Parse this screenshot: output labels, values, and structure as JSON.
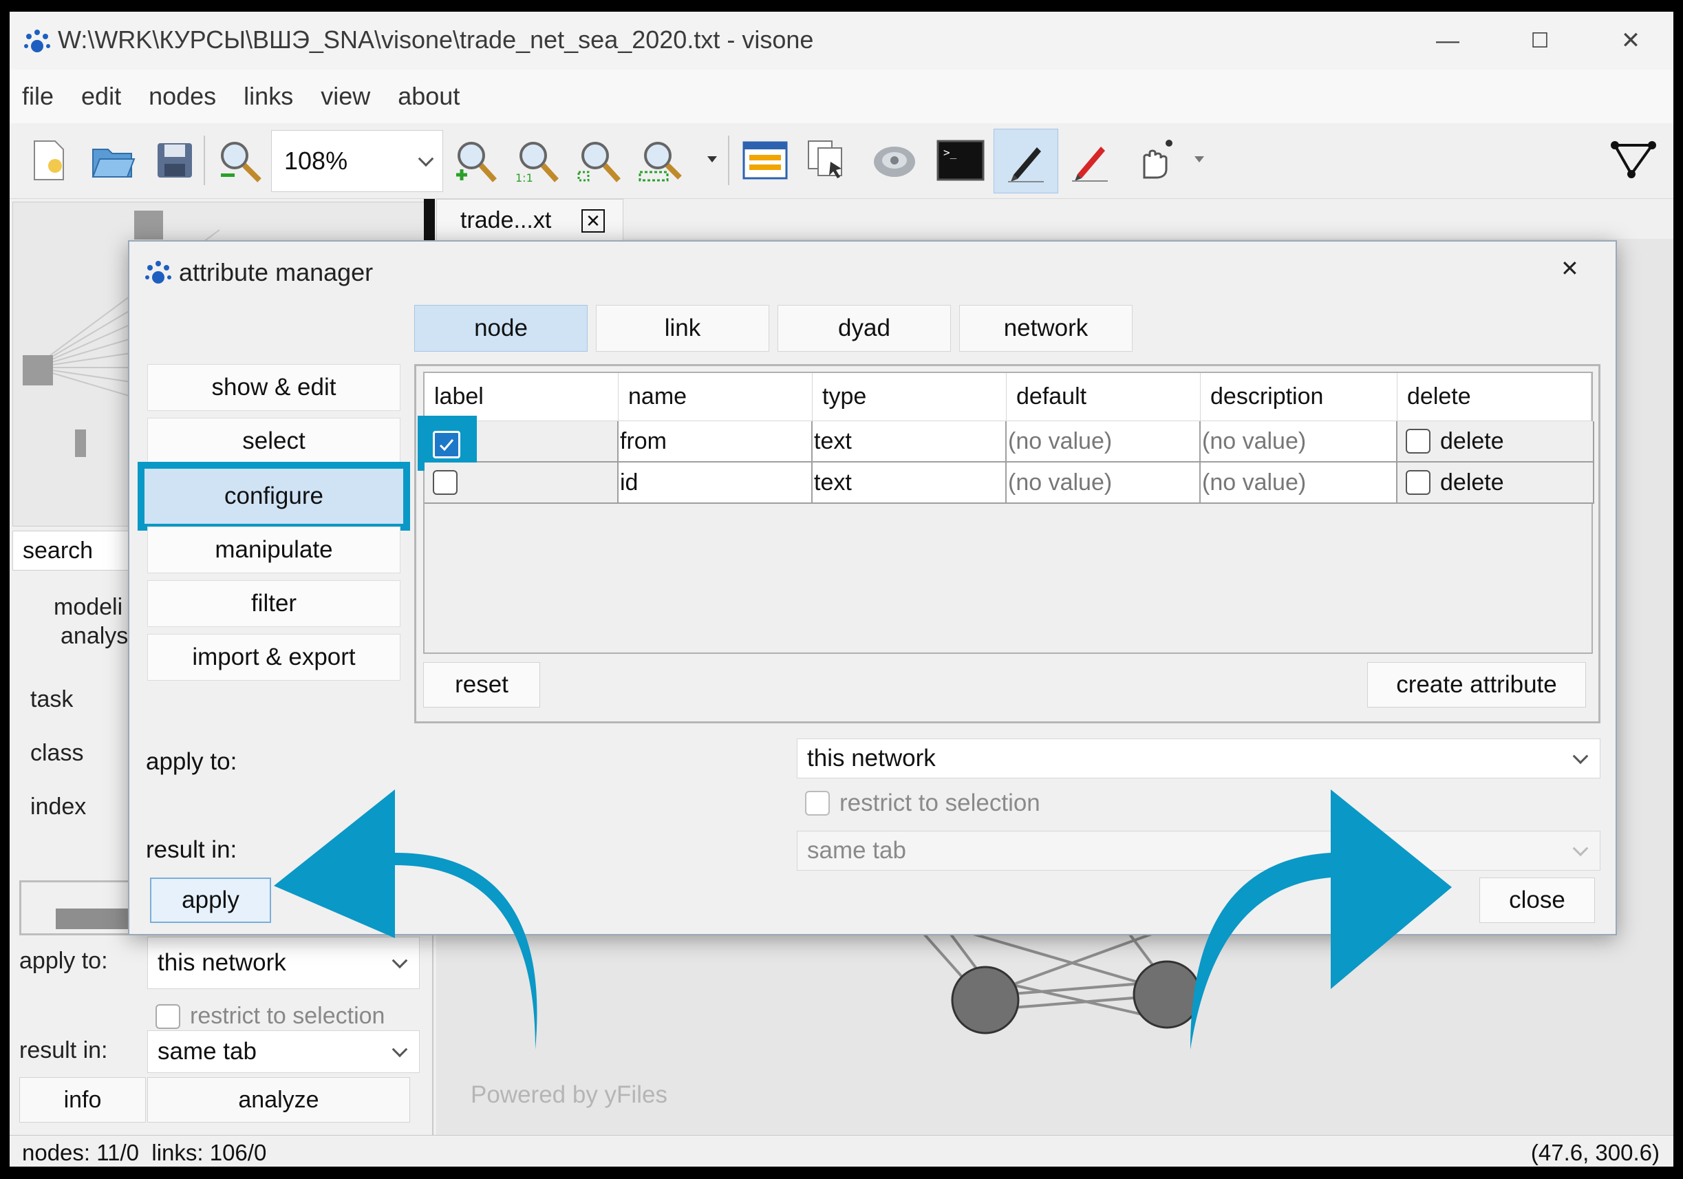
{
  "window": {
    "title": "W:\\WRK\\КУРСЫ\\ВШЭ_SNA\\visone\\trade_net_sea_2020.txt - visone",
    "minimize": "—",
    "maximize": "☐",
    "close": "✕"
  },
  "menu": [
    "file",
    "edit",
    "nodes",
    "links",
    "view",
    "about"
  ],
  "toolbar": {
    "zoom": "108%",
    "icons": [
      "new-file-icon",
      "open-folder-icon",
      "save-disk-icon",
      "zoom-icon",
      "zoom-in-icon",
      "zoom-actual-icon",
      "zoom-fit-icon",
      "zoom-selection-icon",
      "attribute-manager-icon",
      "copy-pages-icon",
      "layout-icon",
      "console-icon",
      "edit-pen-icon",
      "red-pen-icon",
      "touch-icon",
      "network-icon"
    ]
  },
  "doc_tab": {
    "label": "trade...xt",
    "close": "✕"
  },
  "left_panel": {
    "search_label": "search",
    "modeling_line1": "modeli",
    "modeling_line2": "analys",
    "task": "task",
    "class": "class",
    "index": "index",
    "apply_to_label": "apply to:",
    "apply_to_value": "this network",
    "restrict": "restrict to selection",
    "result_in_label": "result in:",
    "result_in_value": "same tab",
    "info": "info",
    "analyze": "analyze"
  },
  "canvas": {
    "watermark": "Powered by yFiles"
  },
  "status": {
    "left": "nodes: 11/0  links: 106/0",
    "right": "(47.6, 300.6)"
  },
  "dialog": {
    "title": "attribute manager",
    "close": "✕",
    "tabs": [
      "node",
      "link",
      "dyad",
      "network"
    ],
    "active_tab": "node",
    "side_nav": [
      "show & edit",
      "select",
      "configure",
      "manipulate",
      "filter",
      "import & export"
    ],
    "active_side_nav": "configure",
    "table": {
      "headers": [
        "label",
        "name",
        "type",
        "default",
        "description",
        "delete"
      ],
      "rows": [
        {
          "label_checked": true,
          "name": "from",
          "type": "text",
          "default": "(no value)",
          "description": "(no value)",
          "delete": "delete"
        },
        {
          "label_checked": false,
          "name": "id",
          "type": "text",
          "default": "(no value)",
          "description": "(no value)",
          "delete": "delete"
        }
      ]
    },
    "reset": "reset",
    "create_attribute": "create attribute",
    "apply_to_label": "apply to:",
    "apply_to_value": "this network",
    "restrict": "restrict to selection",
    "result_in_label": "result in:",
    "result_in_value": "same tab",
    "apply": "apply",
    "close_button": "close"
  },
  "colors": {
    "accent": "#0a98c6",
    "selection": "#cfe3f5",
    "check": "#1d78c8"
  }
}
